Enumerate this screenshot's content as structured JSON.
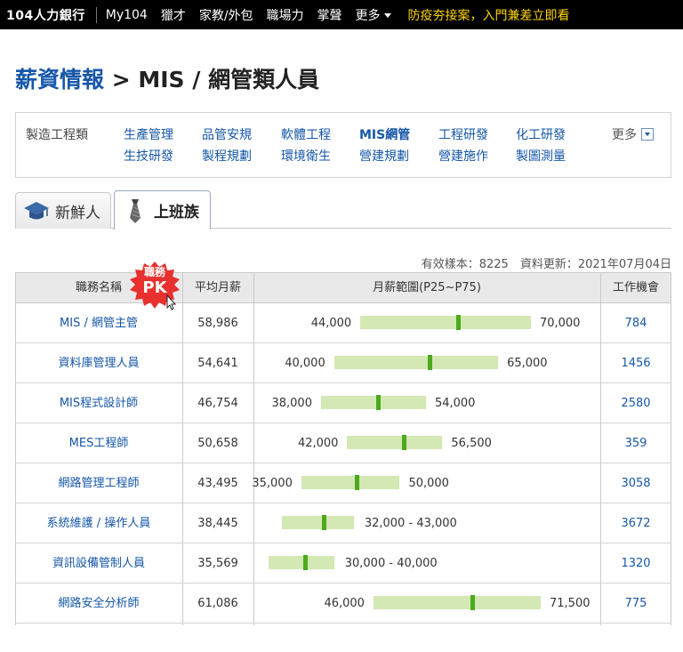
{
  "topbar": {
    "brand": "104人力銀行",
    "nav": [
      "My104",
      "獵才",
      "家教/外包",
      "職場力",
      "掌聲"
    ],
    "more": "更多",
    "promo": "防疫夯接案，入門兼差立即看"
  },
  "title": {
    "link": "薪資情報",
    "separator": " > ",
    "rest": "MIS / 網管類人員"
  },
  "categories": {
    "label": "製造工程類",
    "row1": [
      "生產管理",
      "品管安規",
      "軟體工程",
      "MIS網管",
      "工程研發",
      "化工研發"
    ],
    "row2": [
      "生技研發",
      "製程規劃",
      "環境衛生",
      "營建規劃",
      "營建施作",
      "製圖測量"
    ],
    "active": "MIS網管",
    "more": "更多"
  },
  "tabs": {
    "fresh": "新鮮人",
    "worker": "上班族"
  },
  "meta": "有效樣本：8225　資料更新：2021年07月04日",
  "pk_badge": {
    "line1": "職務",
    "line2": "PK"
  },
  "table": {
    "headers": [
      "職務名稱",
      "平均月薪",
      "月薪範圍(P25~P75)",
      "工作機會"
    ],
    "rows": [
      {
        "name": "MIS / 網管主管",
        "avg": "58,986",
        "low": "44,000",
        "high": "70,000",
        "lowv": 44000,
        "highv": 70000,
        "avgv": 58986,
        "jobs": "784",
        "inline": false
      },
      {
        "name": "資料庫管理人員",
        "avg": "54,641",
        "low": "40,000",
        "high": "65,000",
        "lowv": 40000,
        "highv": 65000,
        "avgv": 54641,
        "jobs": "1456",
        "inline": false
      },
      {
        "name": "MIS程式設計師",
        "avg": "46,754",
        "low": "38,000",
        "high": "54,000",
        "lowv": 38000,
        "highv": 54000,
        "avgv": 46754,
        "jobs": "2580",
        "inline": false
      },
      {
        "name": "MES工程師",
        "avg": "50,658",
        "low": "42,000",
        "high": "56,500",
        "lowv": 42000,
        "highv": 56500,
        "avgv": 50658,
        "jobs": "359",
        "inline": false
      },
      {
        "name": "網路管理工程師",
        "avg": "43,495",
        "low": "35,000",
        "high": "50,000",
        "lowv": 35000,
        "highv": 50000,
        "avgv": 43495,
        "jobs": "3058",
        "inline": false
      },
      {
        "name": "系統維護 / 操作人員",
        "avg": "38,445",
        "low": "32,000",
        "high": "43,000",
        "lowv": 32000,
        "highv": 43000,
        "avgv": 38445,
        "jobs": "3672",
        "inline": true
      },
      {
        "name": "資訊設備管制人員",
        "avg": "35,569",
        "low": "30,000",
        "high": "40,000",
        "lowv": 30000,
        "highv": 40000,
        "avgv": 35569,
        "jobs": "1320",
        "inline": true
      },
      {
        "name": "網路安全分析師",
        "avg": "61,086",
        "low": "46,000",
        "high": "71,500",
        "lowv": 46000,
        "highv": 71500,
        "avgv": 61086,
        "jobs": "775",
        "inline": false
      }
    ]
  },
  "colors": {
    "link": "#1657a8",
    "bar": "#d4e8b4",
    "median": "#4caa1c",
    "promo": "#ffd400",
    "pk": "#e8302e"
  }
}
